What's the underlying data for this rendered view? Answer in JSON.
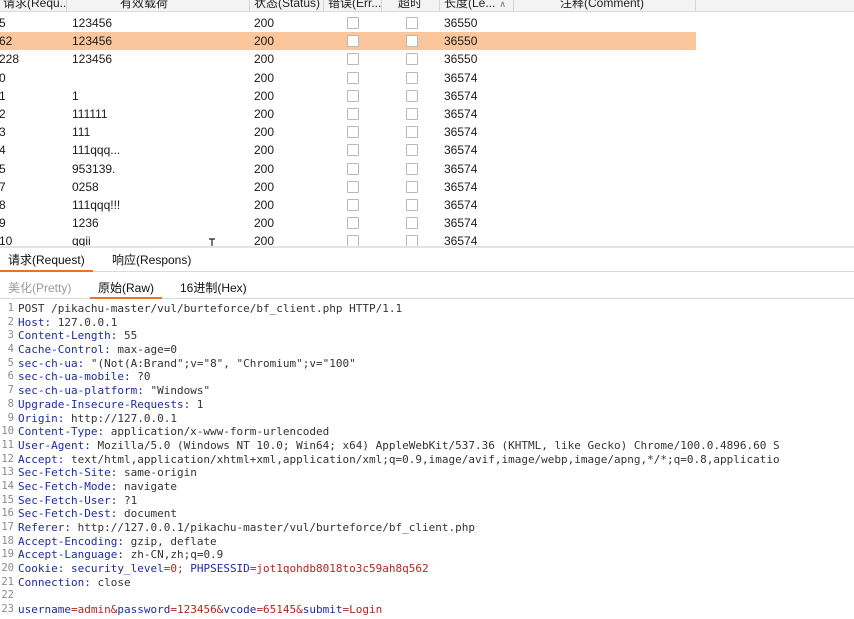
{
  "table": {
    "headers": [
      {
        "key": "req",
        "label": "请求(Requ..."
      },
      {
        "key": "payload",
        "label": "有效载荷"
      },
      {
        "key": "status",
        "label": "状态(Status)"
      },
      {
        "key": "error",
        "label": "错误(Err..."
      },
      {
        "key": "timeout",
        "label": "超时"
      },
      {
        "key": "length",
        "label": "长度(Le..."
      },
      {
        "key": "comment",
        "label": "注释(Comment)"
      }
    ],
    "sort_icon": "sort-chevron-icon",
    "selected_row": 1,
    "selected_color": "#fbc69c",
    "rows": [
      {
        "req": "5",
        "payload": "123456",
        "status": "200",
        "length": "36550"
      },
      {
        "req": "62",
        "payload": "123456",
        "status": "200",
        "length": "36550"
      },
      {
        "req": "228",
        "payload": "123456",
        "status": "200",
        "length": "36550"
      },
      {
        "req": "0",
        "payload": "",
        "status": "200",
        "length": "36574"
      },
      {
        "req": "1",
        "payload": "1",
        "status": "200",
        "length": "36574"
      },
      {
        "req": "2",
        "payload": "111111",
        "status": "200",
        "length": "36574"
      },
      {
        "req": "3",
        "payload": "111",
        "status": "200",
        "length": "36574"
      },
      {
        "req": "4",
        "payload": "111qqq...",
        "status": "200",
        "length": "36574"
      },
      {
        "req": "5",
        "payload": "953139.",
        "status": "200",
        "length": "36574"
      },
      {
        "req": "7",
        "payload": "0258",
        "status": "200",
        "length": "36574"
      },
      {
        "req": "8",
        "payload": "111qqq!!!",
        "status": "200",
        "length": "36574"
      },
      {
        "req": "9",
        "payload": "1236",
        "status": "200",
        "length": "36574"
      },
      {
        "req": "10",
        "payload": "qqii",
        "status": "200",
        "length": "36574"
      }
    ]
  },
  "tabs_primary": [
    {
      "label": "请求(Request)",
      "active": true
    },
    {
      "label": "响应(Respons)",
      "active": false
    }
  ],
  "tabs_secondary": [
    {
      "label": "美化(Pretty)",
      "active": false,
      "disabled": true
    },
    {
      "label": "原始(Raw)",
      "active": true,
      "disabled": false
    },
    {
      "label": "16进制(Hex)",
      "active": false,
      "disabled": false
    }
  ],
  "accent_color": "#e8732b",
  "request_raw": {
    "lines": [
      {
        "n": "1",
        "parts": [
          {
            "t": "POST /pikachu-master/vul/burteforce/bf_client.php HTTP/1.1",
            "c": "p"
          }
        ]
      },
      {
        "n": "2",
        "parts": [
          {
            "t": "Host:",
            "c": "k"
          },
          {
            "t": " 127.0.0.1",
            "c": "v"
          }
        ]
      },
      {
        "n": "3",
        "parts": [
          {
            "t": "Content-Length:",
            "c": "k"
          },
          {
            "t": " 55",
            "c": "v"
          }
        ]
      },
      {
        "n": "4",
        "parts": [
          {
            "t": "Cache-Control:",
            "c": "k"
          },
          {
            "t": " max-age=0",
            "c": "v"
          }
        ]
      },
      {
        "n": "5",
        "parts": [
          {
            "t": "sec-ch-ua:",
            "c": "k"
          },
          {
            "t": " \"(Not(A:Brand\";v=\"8\", \"Chromium\";v=\"100\"",
            "c": "v"
          }
        ]
      },
      {
        "n": "6",
        "parts": [
          {
            "t": "sec-ch-ua-mobile:",
            "c": "k"
          },
          {
            "t": " ?0",
            "c": "v"
          }
        ]
      },
      {
        "n": "7",
        "parts": [
          {
            "t": "sec-ch-ua-platform:",
            "c": "k"
          },
          {
            "t": " \"Windows\"",
            "c": "v"
          }
        ]
      },
      {
        "n": "8",
        "parts": [
          {
            "t": "Upgrade-Insecure-Requests:",
            "c": "k"
          },
          {
            "t": " 1",
            "c": "v"
          }
        ]
      },
      {
        "n": "9",
        "parts": [
          {
            "t": "Origin:",
            "c": "k"
          },
          {
            "t": " http://127.0.0.1",
            "c": "v"
          }
        ]
      },
      {
        "n": "10",
        "parts": [
          {
            "t": "Content-Type:",
            "c": "k"
          },
          {
            "t": " application/x-www-form-urlencoded",
            "c": "v"
          }
        ]
      },
      {
        "n": "11",
        "parts": [
          {
            "t": "User-Agent:",
            "c": "k"
          },
          {
            "t": " Mozilla/5.0 (Windows NT 10.0; Win64; x64) AppleWebKit/537.36 (KHTML, like Gecko) Chrome/100.0.4896.60 S",
            "c": "v"
          }
        ]
      },
      {
        "n": "12",
        "parts": [
          {
            "t": "Accept:",
            "c": "k"
          },
          {
            "t": " text/html,application/xhtml+xml,application/xml;q=0.9,image/avif,image/webp,image/apng,*/*;q=0.8,applicatio",
            "c": "v"
          }
        ]
      },
      {
        "n": "13",
        "parts": [
          {
            "t": "Sec-Fetch-Site:",
            "c": "k"
          },
          {
            "t": " same-origin",
            "c": "v"
          }
        ]
      },
      {
        "n": "14",
        "parts": [
          {
            "t": "Sec-Fetch-Mode:",
            "c": "k"
          },
          {
            "t": " navigate",
            "c": "v"
          }
        ]
      },
      {
        "n": "15",
        "parts": [
          {
            "t": "Sec-Fetch-User:",
            "c": "k"
          },
          {
            "t": " ?1",
            "c": "v"
          }
        ]
      },
      {
        "n": "16",
        "parts": [
          {
            "t": "Sec-Fetch-Dest:",
            "c": "k"
          },
          {
            "t": " document",
            "c": "v"
          }
        ]
      },
      {
        "n": "17",
        "parts": [
          {
            "t": "Referer:",
            "c": "k"
          },
          {
            "t": " http://127.0.0.1/pikachu-master/vul/burteforce/bf_client.php",
            "c": "v"
          }
        ]
      },
      {
        "n": "18",
        "parts": [
          {
            "t": "Accept-Encoding:",
            "c": "k"
          },
          {
            "t": " gzip, deflate",
            "c": "v"
          }
        ]
      },
      {
        "n": "19",
        "parts": [
          {
            "t": "Accept-Language:",
            "c": "k"
          },
          {
            "t": " zh-CN,zh;q=0.9",
            "c": "v"
          }
        ]
      },
      {
        "n": "20",
        "parts": [
          {
            "t": "Cookie:",
            "c": "k"
          },
          {
            "t": " security_level",
            "c": "k"
          },
          {
            "t": "=0; ",
            "c": "r"
          },
          {
            "t": "PHPSESSID",
            "c": "k"
          },
          {
            "t": "=jot1qohdb8018to3c59ah8q562",
            "c": "r"
          }
        ]
      },
      {
        "n": "21",
        "parts": [
          {
            "t": "Connection:",
            "c": "k"
          },
          {
            "t": " close",
            "c": "v"
          }
        ]
      },
      {
        "n": "22",
        "parts": []
      },
      {
        "n": "23",
        "parts": [
          {
            "t": "username",
            "c": "k"
          },
          {
            "t": "=admin&",
            "c": "r"
          },
          {
            "t": "password",
            "c": "k"
          },
          {
            "t": "=123456&",
            "c": "r"
          },
          {
            "t": "vcode",
            "c": "k"
          },
          {
            "t": "=65145&",
            "c": "r"
          },
          {
            "t": "submit",
            "c": "k"
          },
          {
            "t": "=Login",
            "c": "r"
          }
        ]
      }
    ]
  }
}
